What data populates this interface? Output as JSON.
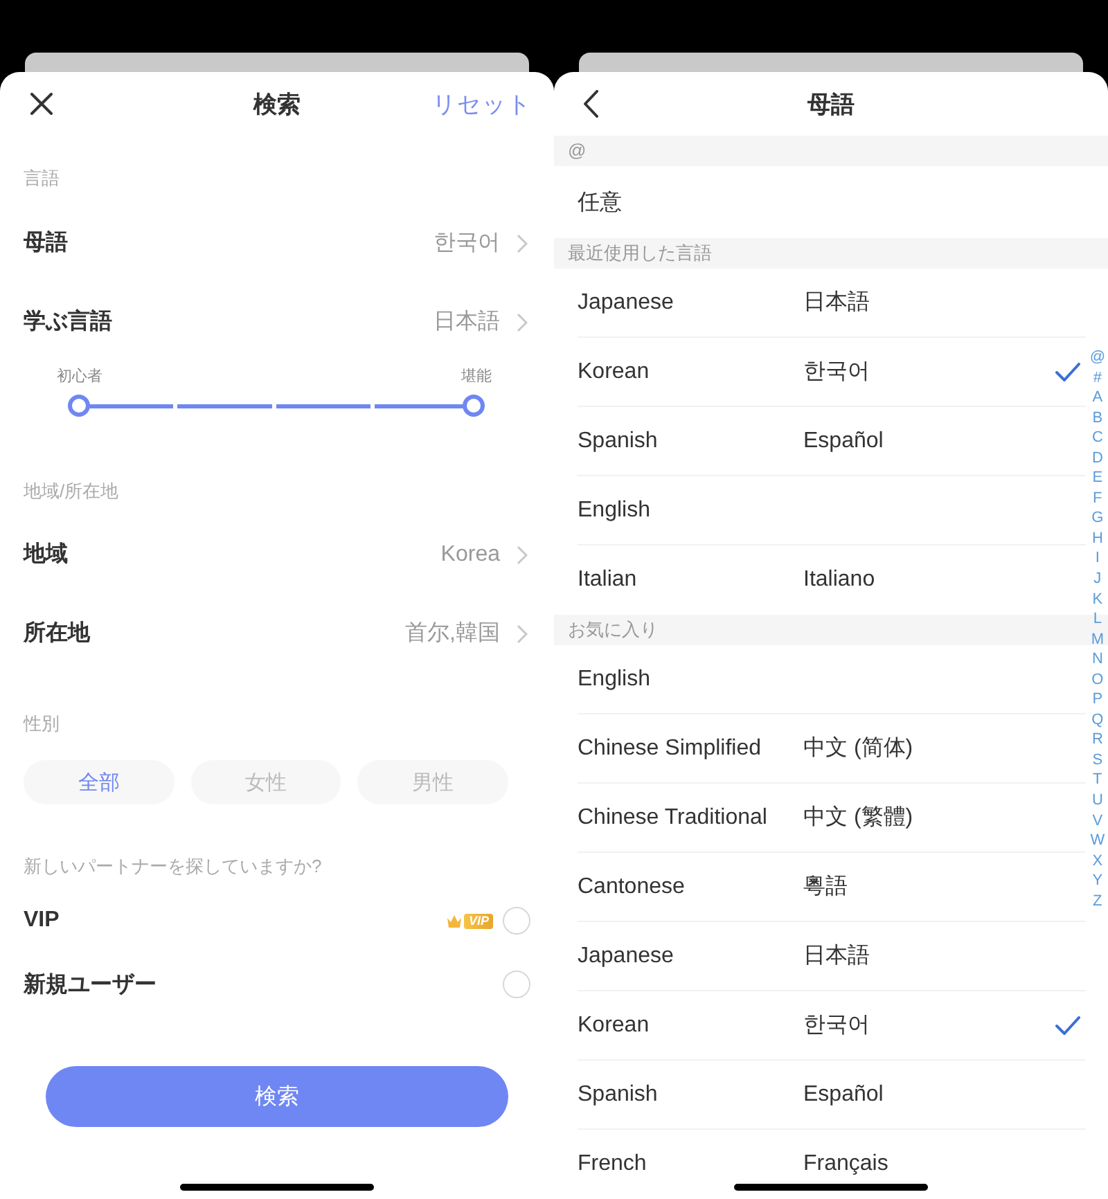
{
  "search": {
    "title": "検索",
    "reset": "リセット",
    "language": {
      "header": "言語",
      "rows": [
        {
          "label": "母語",
          "value": "한국어"
        },
        {
          "label": "学ぶ言語",
          "value": "日本語"
        }
      ],
      "slider": {
        "min_label": "初心者",
        "max_label": "堪能",
        "handles": [
          {
            "level": 0
          },
          {
            "level": 1
          }
        ]
      }
    },
    "region": {
      "header": "地域/所在地",
      "rows": [
        {
          "label": "地域",
          "value": "Korea"
        },
        {
          "label": "所在地",
          "value": "首尔,韓国"
        }
      ]
    },
    "gender": {
      "header": "性別",
      "options": [
        {
          "label": "全部",
          "selected": true
        },
        {
          "label": "女性",
          "selected": false
        },
        {
          "label": "男性",
          "selected": false
        }
      ]
    },
    "partner": {
      "header": "新しいパートナーを探していますか?",
      "options": [
        {
          "label": "VIP",
          "badge": "VIP",
          "checked": false
        },
        {
          "label": "新規ユーザー",
          "checked": false
        }
      ]
    },
    "search_button": "検索"
  },
  "native_language": {
    "title": "母語",
    "groups": [
      {
        "header": "@",
        "items": [
          {
            "name": "任意",
            "selected": false
          }
        ]
      },
      {
        "header": "最近使用した言語",
        "items": [
          {
            "name": "Japanese",
            "native": "日本語",
            "selected": false
          },
          {
            "name": "Korean",
            "native": "한국어",
            "selected": true
          },
          {
            "name": "Spanish",
            "native": "Español",
            "selected": false
          },
          {
            "name": "English",
            "selected": false
          },
          {
            "name": "Italian",
            "native": "Italiano",
            "selected": false
          }
        ]
      },
      {
        "header": "お気に入り",
        "items": [
          {
            "name": "English",
            "selected": false
          },
          {
            "name": "Chinese Simplified",
            "native": "中文 (简体)",
            "selected": false
          },
          {
            "name": "Chinese Traditional",
            "native": "中文 (繁體)",
            "selected": false
          },
          {
            "name": "Cantonese",
            "native": "粵語",
            "selected": false
          },
          {
            "name": "Japanese",
            "native": "日本語",
            "selected": false
          },
          {
            "name": "Korean",
            "native": "한국어",
            "selected": true
          },
          {
            "name": "Spanish",
            "native": "Español",
            "selected": false
          },
          {
            "name": "French",
            "native": "Français",
            "selected": false
          }
        ]
      }
    ],
    "index": [
      "@",
      "#",
      "A",
      "B",
      "C",
      "D",
      "E",
      "F",
      "G",
      "H",
      "I",
      "J",
      "K",
      "L",
      "M",
      "N",
      "O",
      "P",
      "Q",
      "R",
      "S",
      "T",
      "U",
      "V",
      "W",
      "X",
      "Y",
      "Z"
    ]
  }
}
